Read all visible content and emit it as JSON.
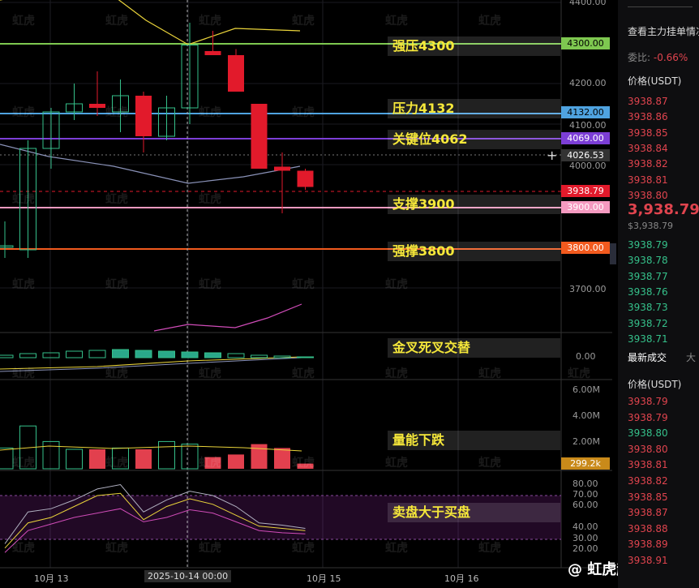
{
  "price_axis": {
    "ticks": [
      "4400.00",
      "4200.00",
      "4100.00",
      "4000.00",
      "3700.00"
    ],
    "macd_ticks": [
      "0.00"
    ],
    "volume_ticks": [
      "6.00M",
      "4.00M",
      "2.00M"
    ],
    "rsi_ticks": [
      "80.00",
      "70.00",
      "60.00",
      "40.00",
      "30.00",
      "20.00"
    ]
  },
  "levels": [
    {
      "text": "强压4300",
      "price_box": "4300.00",
      "color": "#7ec850"
    },
    {
      "text": "压力4132",
      "price_box": "4132.00",
      "color": "#4fa3e0"
    },
    {
      "text": "关键位4062",
      "price_box": "4069.00",
      "color": "#7c3ed6"
    },
    {
      "text": "支撑3900",
      "price_box": "3900.00",
      "color": "#f59ac0"
    },
    {
      "text": "强撑3800",
      "price_box": "3800.00",
      "color": "#f25a1e"
    }
  ],
  "panel_labels": {
    "macd": "金叉死叉交替",
    "volume": "量能下跌",
    "rsi": "卖盘大于买盘"
  },
  "crosshair_price": "4026.53",
  "current_price_box": "3938.79",
  "volume_box": "299.2k",
  "x_axis": {
    "label1": "10月 13",
    "label2": "2025-10-14 00:00",
    "label3": "10月 15",
    "label4": "10月 16"
  },
  "right_panel": {
    "title": "查看主力挂单情况",
    "ratio_label": "委比:",
    "ratio_value": "-0.66%",
    "price_header": "价格(USDT)",
    "asks": [
      "3938.87",
      "3938.86",
      "3938.85",
      "3938.84",
      "3938.82",
      "3938.81",
      "3938.80"
    ],
    "last_price": "3,938.79",
    "last_price_usd": "$3,938.79",
    "bids": [
      "3938.79",
      "3938.78",
      "3938.77",
      "3938.76",
      "3938.73",
      "3938.72",
      "3938.71"
    ],
    "tab_latest": "最新成交",
    "tab_big": "大",
    "trades_header": "价格(USDT)",
    "trades": [
      {
        "p": "3938.79",
        "c": "red"
      },
      {
        "p": "3938.79",
        "c": "red"
      },
      {
        "p": "3938.80",
        "c": "grn"
      },
      {
        "p": "3938.80",
        "c": "red"
      },
      {
        "p": "3938.81",
        "c": "red"
      },
      {
        "p": "3938.82",
        "c": "red"
      },
      {
        "p": "3938.85",
        "c": "red"
      },
      {
        "p": "3938.87",
        "c": "red"
      },
      {
        "p": "3938.88",
        "c": "red"
      },
      {
        "p": "3938.89",
        "c": "red"
      },
      {
        "p": "3938.91",
        "c": "red"
      }
    ]
  },
  "watermark": {
    "small": "虹虎",
    "brand": "@ 虹虎趋势"
  },
  "chart_data": {
    "type": "candlestick",
    "candles": [
      {
        "o": 3800,
        "h": 3860,
        "l": 3770,
        "c": 3800
      },
      {
        "o": 3790,
        "h": 4060,
        "l": 3770,
        "c": 4040
      },
      {
        "o": 4040,
        "h": 4140,
        "l": 3990,
        "c": 4130
      },
      {
        "o": 4130,
        "h": 4200,
        "l": 4110,
        "c": 4150
      },
      {
        "o": 4150,
        "h": 4230,
        "l": 4120,
        "c": 4140
      },
      {
        "o": 4130,
        "h": 4210,
        "l": 4080,
        "c": 4170
      },
      {
        "o": 4170,
        "h": 4180,
        "l": 4030,
        "c": 4070
      },
      {
        "o": 4070,
        "h": 4170,
        "l": 4060,
        "c": 4140
      },
      {
        "o": 4140,
        "h": 4350,
        "l": 4100,
        "c": 4295
      },
      {
        "o": 4280,
        "h": 4330,
        "l": 4270,
        "c": 4270
      },
      {
        "o": 4270,
        "h": 4285,
        "l": 4180,
        "c": 4180
      },
      {
        "o": 4150,
        "h": 4150,
        "l": 3990,
        "c": 3990
      },
      {
        "o": 3995,
        "h": 4030,
        "l": 3880,
        "c": 3985
      },
      {
        "o": 3985,
        "h": 3990,
        "l": 3938,
        "c": 3945
      }
    ],
    "volume": [
      1.6,
      3.3,
      2.1,
      1.5,
      1.5,
      1.6,
      1.5,
      2.1,
      1.9,
      0.9,
      1.1,
      1.9,
      1.6,
      0.4
    ],
    "macd_hist": [
      0.3,
      0.5,
      0.6,
      0.8,
      0.9,
      1.0,
      0.9,
      0.8,
      0.7,
      0.6,
      0.5,
      0.3,
      0.2,
      0.1
    ],
    "rsi_a": [
      22,
      45,
      50,
      60,
      70,
      72,
      48,
      60,
      67,
      62,
      52,
      42,
      40,
      38
    ],
    "rsi_b": [
      18,
      38,
      44,
      50,
      54,
      58,
      46,
      50,
      57,
      54,
      46,
      38,
      36,
      35
    ],
    "rsi_c": [
      26,
      55,
      58,
      66,
      76,
      80,
      55,
      66,
      74,
      70,
      60,
      45,
      43,
      40
    ]
  }
}
